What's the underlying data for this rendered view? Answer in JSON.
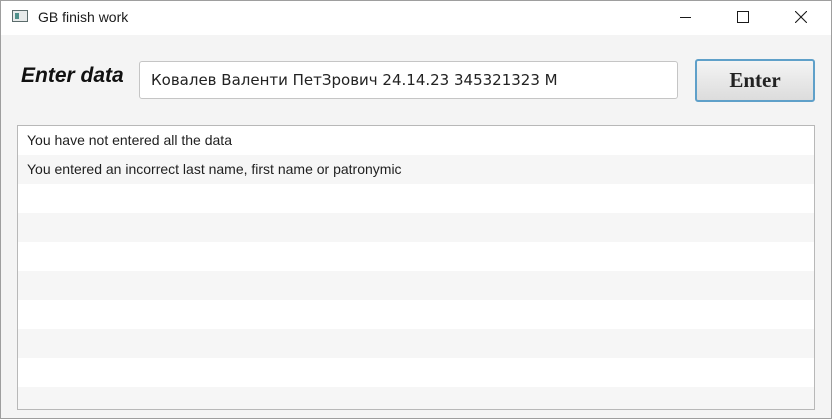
{
  "window": {
    "title": "GB finish work"
  },
  "form": {
    "label": "Enter data",
    "input_value": "Ковалев Валенти ПетЗрович 24.14.23 345321323 M",
    "button_label": "Enter"
  },
  "messages": [
    "You have not entered all the data",
    "You entered an incorrect last name, first name or patronymic",
    "",
    "",
    "",
    "",
    "",
    "",
    "",
    ""
  ]
}
